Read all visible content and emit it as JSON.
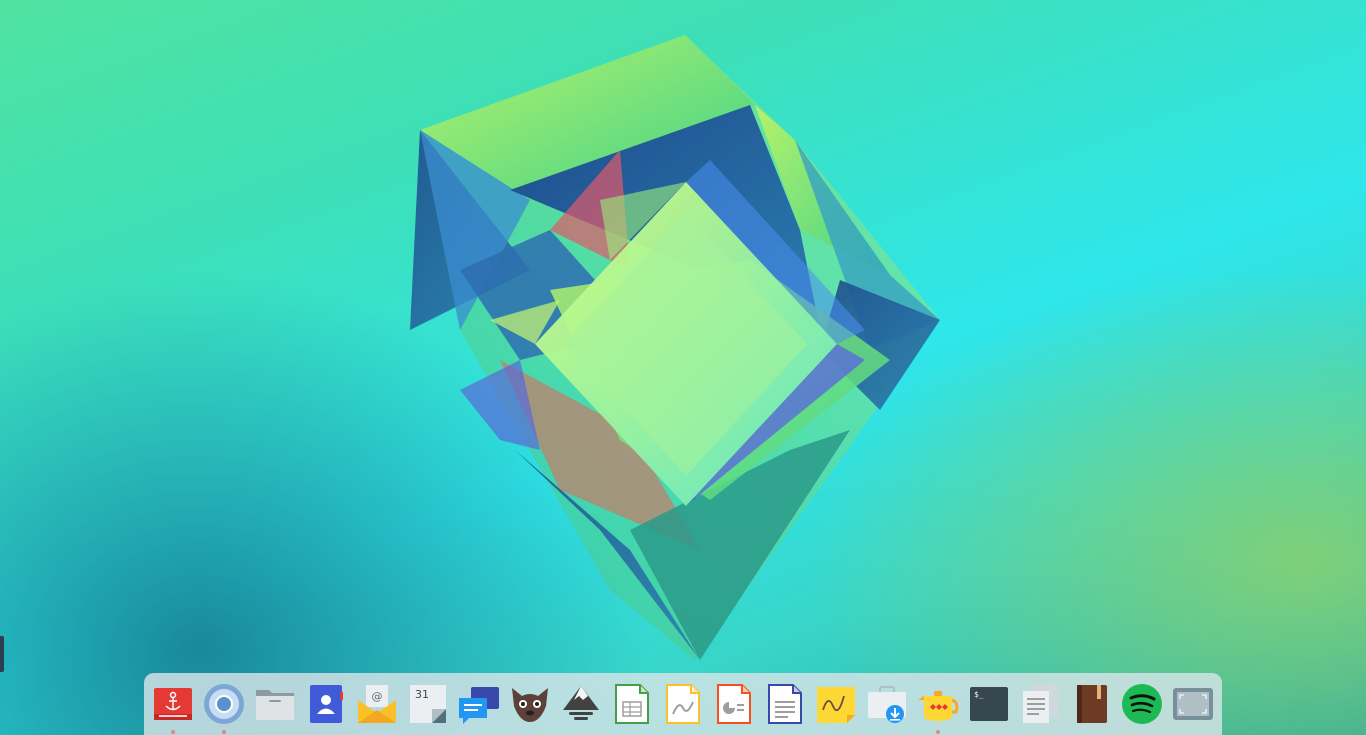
{
  "desktop": {
    "wallpaper": "abstract-green-crystal",
    "colors": {
      "top": "#2fe6ea",
      "left": "#4fe3a0",
      "bottom_left": "#2aa6a0",
      "bottom_right": "#8cd26e"
    }
  },
  "dock": {
    "background": "#d7e4e8",
    "items": [
      {
        "id": "anchor",
        "icon": "anchor-icon",
        "running": true
      },
      {
        "id": "chromium",
        "icon": "chromium-icon",
        "running": true
      },
      {
        "id": "files",
        "icon": "folder-icon",
        "running": false
      },
      {
        "id": "contacts",
        "icon": "contacts-icon",
        "running": false
      },
      {
        "id": "mail",
        "icon": "mail-icon",
        "running": false
      },
      {
        "id": "calendar",
        "icon": "calendar-icon",
        "running": false,
        "label": "31"
      },
      {
        "id": "messaging",
        "icon": "chat-icon",
        "running": false
      },
      {
        "id": "gimp",
        "icon": "gimp-icon",
        "running": false
      },
      {
        "id": "inkscape",
        "icon": "inkscape-icon",
        "running": false
      },
      {
        "id": "calc",
        "icon": "spreadsheet-icon",
        "running": false
      },
      {
        "id": "draw",
        "icon": "draw-icon",
        "running": false
      },
      {
        "id": "impress",
        "icon": "presentation-icon",
        "running": false
      },
      {
        "id": "writer",
        "icon": "document-icon",
        "running": false
      },
      {
        "id": "notes",
        "icon": "sticky-note-icon",
        "running": false
      },
      {
        "id": "software",
        "icon": "software-center-icon",
        "running": false
      },
      {
        "id": "tea",
        "icon": "teapot-icon",
        "running": true
      },
      {
        "id": "terminal",
        "icon": "terminal-icon",
        "running": false,
        "label": "$_"
      },
      {
        "id": "text-editor",
        "icon": "text-editor-icon",
        "running": false
      },
      {
        "id": "book-reader",
        "icon": "book-icon",
        "running": false
      },
      {
        "id": "spotify",
        "icon": "spotify-icon",
        "running": false
      },
      {
        "id": "screenshot",
        "icon": "screenshot-icon",
        "running": false
      }
    ]
  }
}
